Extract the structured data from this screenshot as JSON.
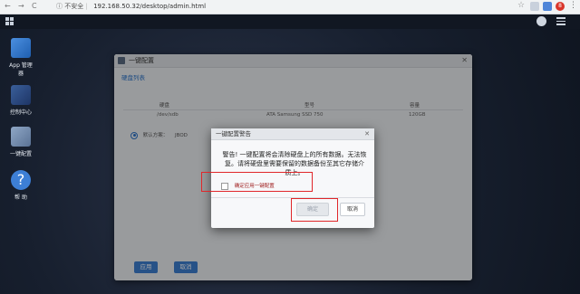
{
  "browser": {
    "back": "←",
    "forward": "→",
    "reload": "C",
    "security_label": "不安全",
    "url": "192.168.50.32/desktop/admin.html",
    "ext_badge": "8"
  },
  "desktop": {
    "apps": [
      {
        "label": "App 管理器",
        "icon": "app-manager-icon"
      },
      {
        "label": "控制中心",
        "icon": "control-center-icon"
      },
      {
        "label": "一键配置",
        "icon": "one-click-config-icon"
      },
      {
        "label": "帮 助",
        "icon": "help-icon"
      }
    ]
  },
  "window": {
    "title": "一键配置",
    "close": "✕",
    "section": "硬盘列表",
    "columns": [
      "硬盘",
      "型号",
      "容量"
    ],
    "rows": [
      [
        "/dev/sdb",
        "ATA Samsung SSD 750",
        "120GB"
      ]
    ],
    "scheme_label": "默认方案：",
    "scheme_value": "JBOD",
    "apply_label": "应用",
    "cancel_label": "取消"
  },
  "dialog": {
    "title": "一键配置警告",
    "close": "✕",
    "message": "警告! 一键配置将会清除硬盘上的所有数据。无法恢复。请将硬盘里需要保留的数据备份至其它存储介质上。",
    "confirm_checkbox_label": "确定应用一键配置",
    "ok_label": "确定",
    "cancel_label": "取消"
  },
  "colors": {
    "accent": "#3d7ed0",
    "highlight": "#e0262a"
  }
}
